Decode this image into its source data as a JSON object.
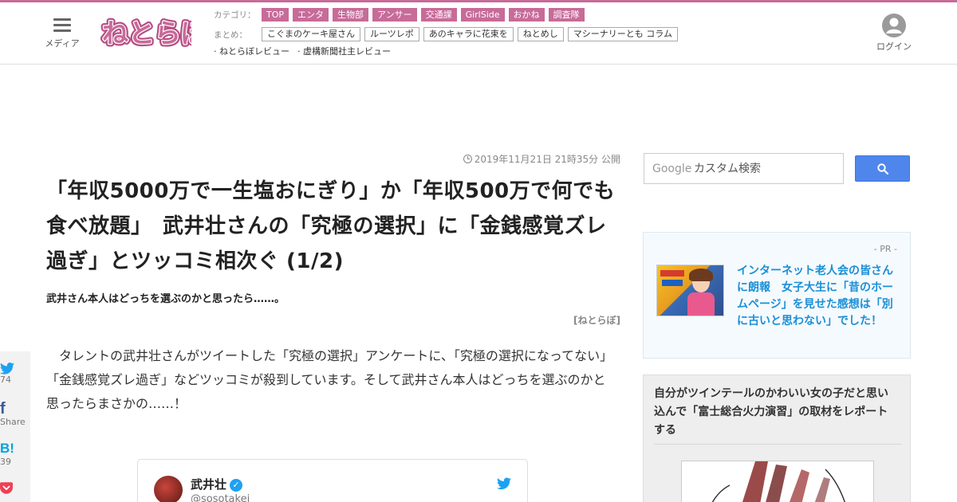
{
  "header": {
    "menu_label": "メディア",
    "logo_text": "ねとらぼ",
    "category_label": "カテゴリ：",
    "categories": [
      "TOP",
      "エンタ",
      "生物部",
      "アンサー",
      "交通課",
      "GirlSide",
      "おかね",
      "調査隊"
    ],
    "summary_label": "まとめ：",
    "summaries": [
      "こぐまのケーキ屋さん",
      "ルーツレポ",
      "あのキャラに花束を",
      "ねとめし",
      "マシーナリーとも コラム"
    ],
    "reviews": [
      "· ねとらぼレビュー",
      "· 虚構新聞社主レビュー"
    ],
    "login_label": "ログイン"
  },
  "article": {
    "published": "2019年11月21日 21時35分 公開",
    "title": "「年収5000万で一生塩おにぎり」か「年収500万で何でも食べ放題」　武井壮さんの「究極の選択」に「金銭感覚ズレ過ぎ」とツッコミ相次ぐ (1/2)",
    "subtitle": "武井さん本人はどっちを選ぶのかと思ったら……。",
    "credit": "[ねとらぼ]",
    "body": "タレントの武井壮さんがツイートした「究極の選択」アンケートに、「究極の選択になってない」「金銭感覚ズレ過ぎ」などツッコミが殺到しています。そして武井さん本人はどっちを選ぶのかと思ったらまさかの……！"
  },
  "tweet": {
    "name": "武井壮",
    "handle": "@sosotakei",
    "verified_mark": "✓"
  },
  "share": {
    "twitter_count": "74",
    "facebook_label": "Share",
    "hatena_label": "B!",
    "hatena_count": "39"
  },
  "sidebar": {
    "search_brand": "Google",
    "search_placeholder": "カスタム検索",
    "pr_label": "- PR -",
    "pr_title": "インターネット老人会の皆さんに朗報　女子大生に「昔のホームページ」を見せた感想は「別に古いと思わない」でした！",
    "related_title": "自分がツインテールのかわいい女の子だと思い込んで「富士総合火力演習」の取材をレポートする"
  },
  "colors": {
    "brand_pink": "#c76b98",
    "link_blue": "#1a8fd6",
    "search_blue": "#4f86ec",
    "twitter_blue": "#1da1f2"
  }
}
